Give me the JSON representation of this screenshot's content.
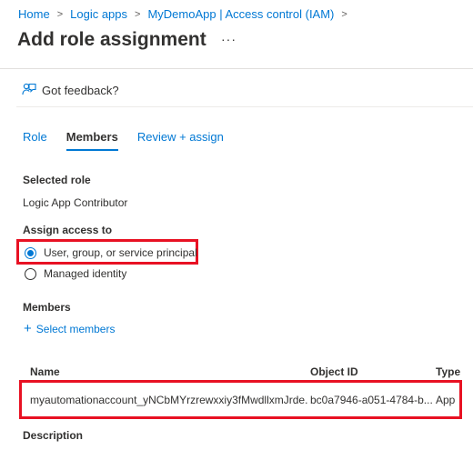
{
  "breadcrumb": [
    "Home",
    "Logic apps",
    "MyDemoApp | Access control (IAM)"
  ],
  "breadcrumb_separator": ">",
  "page_title": "Add role assignment",
  "more_label": "···",
  "feedback_label": "Got feedback?",
  "tabs": [
    {
      "label": "Role",
      "active": false
    },
    {
      "label": "Members",
      "active": true
    },
    {
      "label": "Review + assign",
      "active": false
    }
  ],
  "selected_role": {
    "label": "Selected role",
    "value": "Logic App Contributor"
  },
  "assign_access": {
    "label": "Assign access to",
    "options": [
      {
        "label": "User, group, or service principal",
        "selected": true
      },
      {
        "label": "Managed identity",
        "selected": false
      }
    ]
  },
  "members": {
    "label": "Members",
    "select_label": "Select members",
    "columns": [
      "Name",
      "Object ID",
      "Type"
    ],
    "rows": [
      {
        "name": "myautomationaccount_yNCbMYrzrewxxiy3fMwdllxmJrde...",
        "object_id": "bc0a7946-a051-4784-b...",
        "type": "App"
      }
    ]
  },
  "description_label": "Description",
  "colors": {
    "accent": "#0078d4",
    "highlight": "#e81123",
    "text": "#323130"
  }
}
